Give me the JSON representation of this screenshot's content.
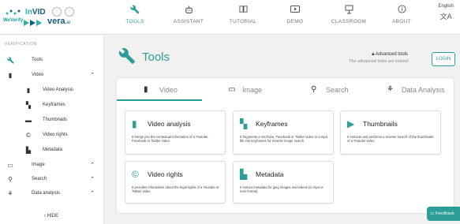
{
  "brand": {
    "invid_part1": "In",
    "invid_part2": "VID",
    "weverify": "WeVerify",
    "vera": "vera",
    "vera_suffix": ".ai"
  },
  "topnav": [
    {
      "label": "TOOLS",
      "icon": "wrench-icon"
    },
    {
      "label": "ASSISTANT",
      "icon": "assistant-icon"
    },
    {
      "label": "TUTORIAL",
      "icon": "book-icon"
    },
    {
      "label": "DEMO",
      "icon": "video-demo-icon"
    },
    {
      "label": "CLASSROOM",
      "icon": "classroom-icon"
    },
    {
      "label": "ABOUT",
      "icon": "info-icon"
    }
  ],
  "language": {
    "label": "English",
    "icon": "translate-icon"
  },
  "sidebar": {
    "section": "VERIFICATION",
    "items": [
      {
        "label": "Tools"
      },
      {
        "label": "Video"
      },
      {
        "label": "Video Analysis"
      },
      {
        "label": "Keyframes"
      },
      {
        "label": "Thumbnails"
      },
      {
        "label": "Video rights"
      },
      {
        "label": "Metadata"
      },
      {
        "label": "Image"
      },
      {
        "label": "Search"
      },
      {
        "label": "Data analysis"
      }
    ],
    "hide": "‹  HIDE"
  },
  "main": {
    "title": "Tools",
    "advanced_title": "Advanced tools",
    "advanced_sub": "The advanced tools are locked",
    "login": "LOGIN",
    "tabs": [
      {
        "label": "Video"
      },
      {
        "label": "Image"
      },
      {
        "label": "Search"
      },
      {
        "label": "Data Analysis"
      }
    ],
    "cards": [
      {
        "title": "Video analysis",
        "desc": "It brings you the contextual information of a Youtube, Facebook or Twitter video"
      },
      {
        "title": "Keyframes",
        "desc": "It fragments a YouTube, Facebook or Twitter video or a mp4 file into keyframes for reverse image search"
      },
      {
        "title": "Thumbnails",
        "desc": "It extracts and performs a reverse search of the thumbnails of a Youtube video"
      },
      {
        "title": "Video rights",
        "desc": "It provides information about the legal rights of a Youtube or Twitter video"
      },
      {
        "title": "Metadata",
        "desc": "It extract metadata for jpeg images and videos (in mp4 or m4v format)"
      }
    ]
  },
  "feedback": "Feedback",
  "colors": {
    "accent": "#2d9e97"
  }
}
